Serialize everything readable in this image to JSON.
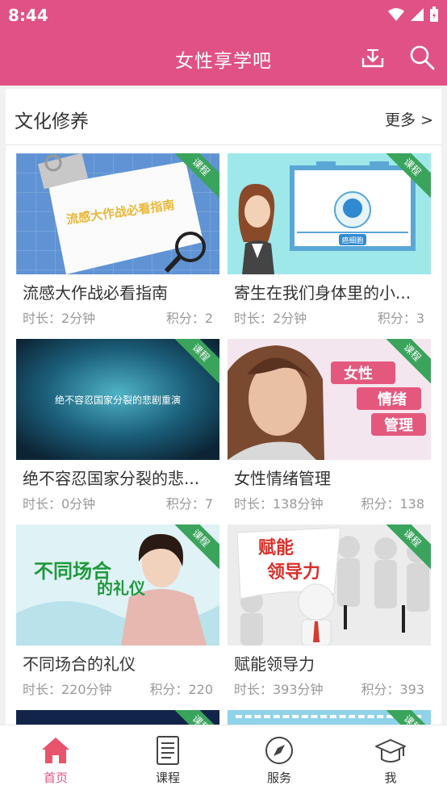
{
  "status_bar": {
    "time": "8:44"
  },
  "app_bar": {
    "title": "女性享学吧"
  },
  "section": {
    "title": "文化修养",
    "more": "更多 >"
  },
  "courses": [
    {
      "title": "流感大作战必看指南",
      "duration": "时长：2分钟",
      "points": "积分：2",
      "thumb_text": "流感大作战必看指南",
      "badge": "课程"
    },
    {
      "title": "寄生在我们身体里的小...",
      "duration": "时长：2分钟",
      "points": "积分：3",
      "thumb_text": "癌细胞",
      "badge": "课程"
    },
    {
      "title": "绝不容忍国家分裂的悲...",
      "duration": "时长：0分钟",
      "points": "积分：7",
      "thumb_text": "绝不容忍国家分裂的悲剧重演",
      "badge": "课程"
    },
    {
      "title": "女性情绪管理",
      "duration": "时长：138分钟",
      "points": "积分：138",
      "thumb_words": [
        "女性",
        "情绪",
        "管理"
      ],
      "badge": "课程"
    },
    {
      "title": "不同场合的礼仪",
      "duration": "时长：220分钟",
      "points": "积分：220",
      "thumb_text": "不同场合",
      "thumb_text2": "的礼仪",
      "badge": "课程"
    },
    {
      "title": "赋能领导力",
      "duration": "时长：393分钟",
      "points": "积分：393",
      "thumb_text": "赋能",
      "thumb_text2": "领导力",
      "badge": "课程"
    }
  ],
  "partial_badges": [
    "课程",
    "课程"
  ],
  "tabs": [
    {
      "label": "首页",
      "icon": "home-icon",
      "active": true
    },
    {
      "label": "课程",
      "icon": "course-icon",
      "active": false
    },
    {
      "label": "服务",
      "icon": "compass-icon",
      "active": false
    },
    {
      "label": "我",
      "icon": "graduation-cap-icon",
      "active": false
    }
  ],
  "colors": {
    "brand": "#e05185",
    "badge": "#3aa35c"
  }
}
